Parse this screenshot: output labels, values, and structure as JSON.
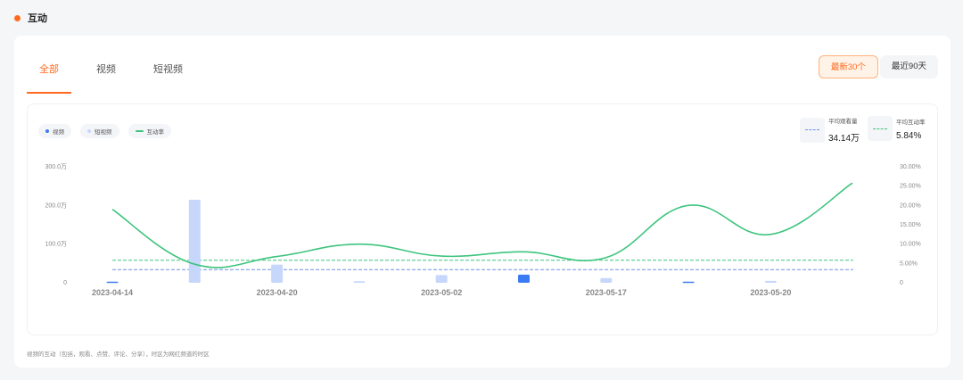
{
  "section": {
    "title": "互动"
  },
  "tabs": [
    {
      "label": "全部"
    },
    {
      "label": "视频"
    },
    {
      "label": "短视频"
    }
  ],
  "range": {
    "recent30": "最新30个",
    "recent90": "最近90天"
  },
  "legend": [
    {
      "label": "视频",
      "color": "#3b7bf3"
    },
    {
      "label": "短视频",
      "color": "#c7d7fb"
    },
    {
      "label": "互动率",
      "color": "#3ec47e"
    }
  ],
  "stats": [
    {
      "label": "平均观看量",
      "value": "34.14万",
      "color": "#6d8fe6"
    },
    {
      "label": "平均互动率",
      "value": "5.84%",
      "color": "#3ec47e"
    }
  ],
  "footnote": "视频的互动（包括，观看、点赞、评论、分享），时区为网红频道的时区",
  "chart_data": {
    "type": "bar",
    "x_ticks": [
      "2023-04-14",
      "2023-04-20",
      "2023-05-02",
      "2023-05-17",
      "2023-05-20"
    ],
    "y_left": {
      "ticks": [
        "0",
        "100.0万",
        "200.0万",
        "300.0万"
      ],
      "range": [
        0,
        300
      ]
    },
    "y_right": {
      "ticks": [
        "0",
        "5.00%",
        "10.00%",
        "15.00%",
        "20.00%",
        "25.00%",
        "30.00%"
      ],
      "range": [
        0,
        30
      ]
    },
    "bars": [
      {
        "i": 0,
        "value": 3,
        "series": "视频"
      },
      {
        "i": 1,
        "value": 215,
        "series": "短视频"
      },
      {
        "i": 2,
        "value": 47,
        "series": "短视频"
      },
      {
        "i": 3,
        "value": 4,
        "series": "短视频"
      },
      {
        "i": 4,
        "value": 20,
        "series": "短视频"
      },
      {
        "i": 5,
        "value": 21,
        "series": "视频"
      },
      {
        "i": 6,
        "value": 12,
        "series": "短视频"
      },
      {
        "i": 7,
        "value": 3,
        "series": "视频"
      },
      {
        "i": 8,
        "value": 5,
        "series": "短视频"
      }
    ],
    "rate_line": [
      19.0,
      4.8,
      6.8,
      10.0,
      6.9,
      8.0,
      6.5,
      20.0,
      12.5,
      25.8
    ],
    "avg_views": 34.14,
    "avg_rate": 5.84
  }
}
